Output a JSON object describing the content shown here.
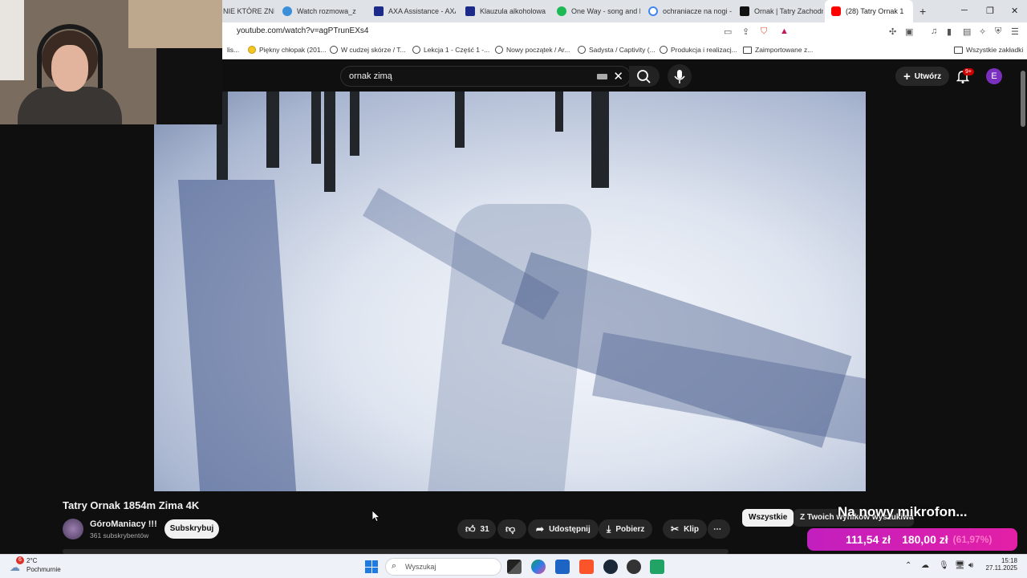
{
  "browser": {
    "tabs": [
      {
        "label": "NIE KTÓRE ZNIK",
        "color": "#dfe3e8"
      },
      {
        "label": "Watch rozmowa_z",
        "color": "#3b8fd8"
      },
      {
        "label": "AXA Assistance - AXA",
        "color": "#1c2a8a"
      },
      {
        "label": "Klauzula alkoholowa",
        "color": "#1c2a8a"
      },
      {
        "label": "One Way - song and ly",
        "color": "#1db954"
      },
      {
        "label": "ochraniacze na nogi -",
        "color": "#4285f4"
      },
      {
        "label": "Ornak | Tatry Zachodn",
        "color": "#111111"
      },
      {
        "label": "(28) Tatry Ornak 1",
        "color": "#ff0000"
      }
    ],
    "new_tab_symbol": "+",
    "url": "youtube.com/watch?v=agPTrunEXs4",
    "bookmarks": [
      {
        "label": "lis...",
        "icon": "none"
      },
      {
        "label": "Piękny chłopak (201...",
        "icon": "coin-icon"
      },
      {
        "label": "W cudzej skórze / T...",
        "icon": "globe-icon"
      },
      {
        "label": "Lekcja 1 - Część 1 -...",
        "icon": "globe-icon"
      },
      {
        "label": "Nowy początek / Ar...",
        "icon": "globe-icon"
      },
      {
        "label": "Sadysta / Captivity (...",
        "icon": "globe-icon"
      },
      {
        "label": "Produkcja i realizacj...",
        "icon": "globe-icon"
      },
      {
        "label": "Zaimportowane z...",
        "icon": "folder-icon"
      },
      {
        "label": "Wszystkie zakładki",
        "icon": "folder-icon"
      }
    ]
  },
  "youtube": {
    "search_query": "ornak zimą",
    "create_label": "Utwórz",
    "notifications_badge": "9+",
    "avatar_letter": "E",
    "video": {
      "title": "Tatry Ornak 1854m Zima 4K",
      "channel": "GóroManiacy !!!",
      "subscribers": "361 subskrybentów",
      "subscribe_label": "Subskrybuj",
      "likes": "31",
      "share_label": "Udostępnij",
      "download_label": "Pobierz",
      "clip_label": "Klip"
    },
    "chips": [
      "Wszystkie",
      "Z Twoich wyników wyszukiwania"
    ],
    "promo": {
      "title": "Na nowy mikrofon...",
      "current": "111,54 zł",
      "goal": "180,00 zł",
      "percent": "(61,97%)"
    }
  },
  "taskbar": {
    "weather_badge": "6",
    "temperature": "2°C",
    "weather": "Pochmurnie",
    "search_placeholder": "Wyszukaj",
    "time": "15:18",
    "date": "27.11.2025"
  }
}
